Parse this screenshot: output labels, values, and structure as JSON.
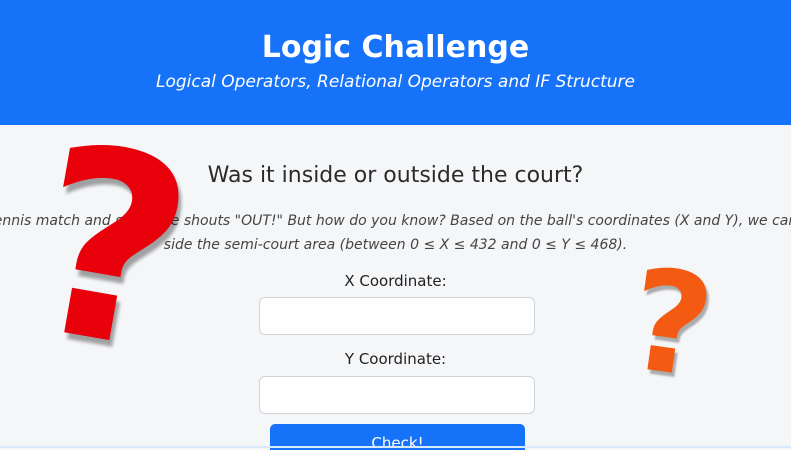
{
  "header": {
    "title": "Logic Challenge",
    "subtitle": "Logical Operators, Relational Operators and IF Structure"
  },
  "main": {
    "question": "Was it inside or outside the court?",
    "description_line1": "ennis match and someone shouts \"OUT!\" But how do you know? Based on the ball's coordinates (X and Y), we can",
    "description_line2": "side the semi-court area (between 0 ≤ X ≤ 432 and 0 ≤ Y ≤ 468).",
    "x_label": "X Coordinate:",
    "x_value": "",
    "y_label": "Y Coordinate:",
    "y_value": "",
    "check_button": "Check!"
  },
  "decor": {
    "red_qmark": "?",
    "orange_qmark": "?",
    "colors": {
      "header_bg": "#1672f8",
      "red": "#e8000b",
      "orange": "#f55a12"
    }
  }
}
